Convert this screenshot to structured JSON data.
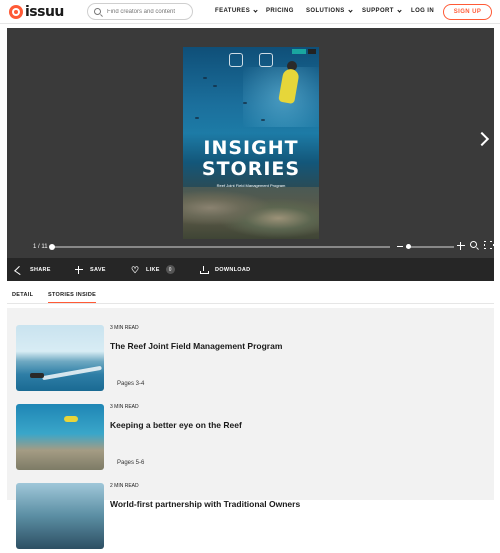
{
  "nav": {
    "logo_text": "issuu",
    "search_placeholder": "Find creators and content",
    "features": "FEATURES",
    "pricing": "PRICING",
    "solutions": "SOLUTIONS",
    "support": "SUPPORT",
    "login": "LOG IN",
    "signup": "SIGN UP"
  },
  "reader": {
    "cover_title_line1": "INSIGHT",
    "cover_title_line2": "STORIES",
    "cover_subtitle": "Reef Joint Field Management Program",
    "page_indicator": "1 / 11",
    "progress_fraction": 0.0,
    "zoom_fraction": 0.0
  },
  "actions": {
    "share": "SHARE",
    "save": "SAVE",
    "like": "LIKE",
    "like_count": "0",
    "download": "DOWNLOAD"
  },
  "tabs": {
    "detail": "DETAIL",
    "stories_inside": "STORIES INSIDE"
  },
  "stories": [
    {
      "read_time": "3 MIN READ",
      "title": "The Reef Joint Field Management Program",
      "pages": "Pages 3-4"
    },
    {
      "read_time": "3 MIN READ",
      "title": "Keeping a better eye on the Reef",
      "pages": "Pages 5-6"
    },
    {
      "read_time": "2 MIN READ",
      "title": "World-first partnership with Traditional Owners",
      "pages": ""
    }
  ],
  "colors": {
    "accent": "#ff5a36",
    "reader_bg": "#3a3a3a",
    "action_bar_bg": "#262626",
    "stories_bg": "#f2f2f2"
  }
}
